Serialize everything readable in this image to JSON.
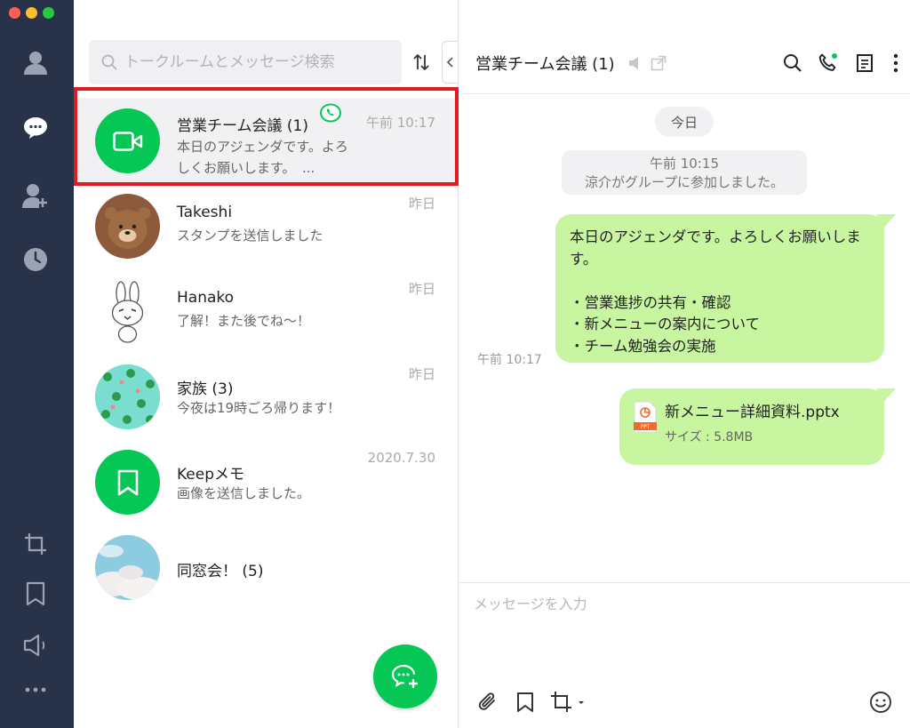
{
  "search": {
    "placeholder": "トークルームとメッセージ検索"
  },
  "chats": [
    {
      "name": "営業チーム会議 (1)",
      "preview": "本日のアジェンダです。よろしくお願いします。　...",
      "time": "午前 10:17"
    },
    {
      "name": "Takeshi",
      "preview": "スタンプを送信しました",
      "time": "昨日"
    },
    {
      "name": "Hanako",
      "preview": "了解！また後でね～！",
      "time": "昨日"
    },
    {
      "name": "家族 (3)",
      "preview": "今夜は19時ごろ帰ります！",
      "time": "昨日"
    },
    {
      "name": "Keepメモ",
      "preview": "画像を送信しました。",
      "time": "2020.7.30"
    },
    {
      "name": "同窓会！ (5)",
      "preview": "",
      "time": ""
    }
  ],
  "chat": {
    "title": "営業チーム会議 (1)",
    "date_chip": "今日",
    "system_time": "午前 10:15",
    "system_text": "涼介がグループに参加しました。",
    "message_text": "本日のアジェンダです。よろしくお願いします。\n\n・営業進捗の共有・確認\n・新メニューの案内について\n・チーム勉強会の実施",
    "message_time": "午前 10:17",
    "file_name": "新メニュー詳細資料.pptx",
    "file_size": "サイズ : 5.8MB",
    "file_badge": "PPT",
    "composer_placeholder": "メッセージを入力"
  },
  "colors": {
    "brand": "#06c755",
    "rail": "#28334a",
    "bubble": "#c7f5a0",
    "highlight": "#e11b22"
  }
}
